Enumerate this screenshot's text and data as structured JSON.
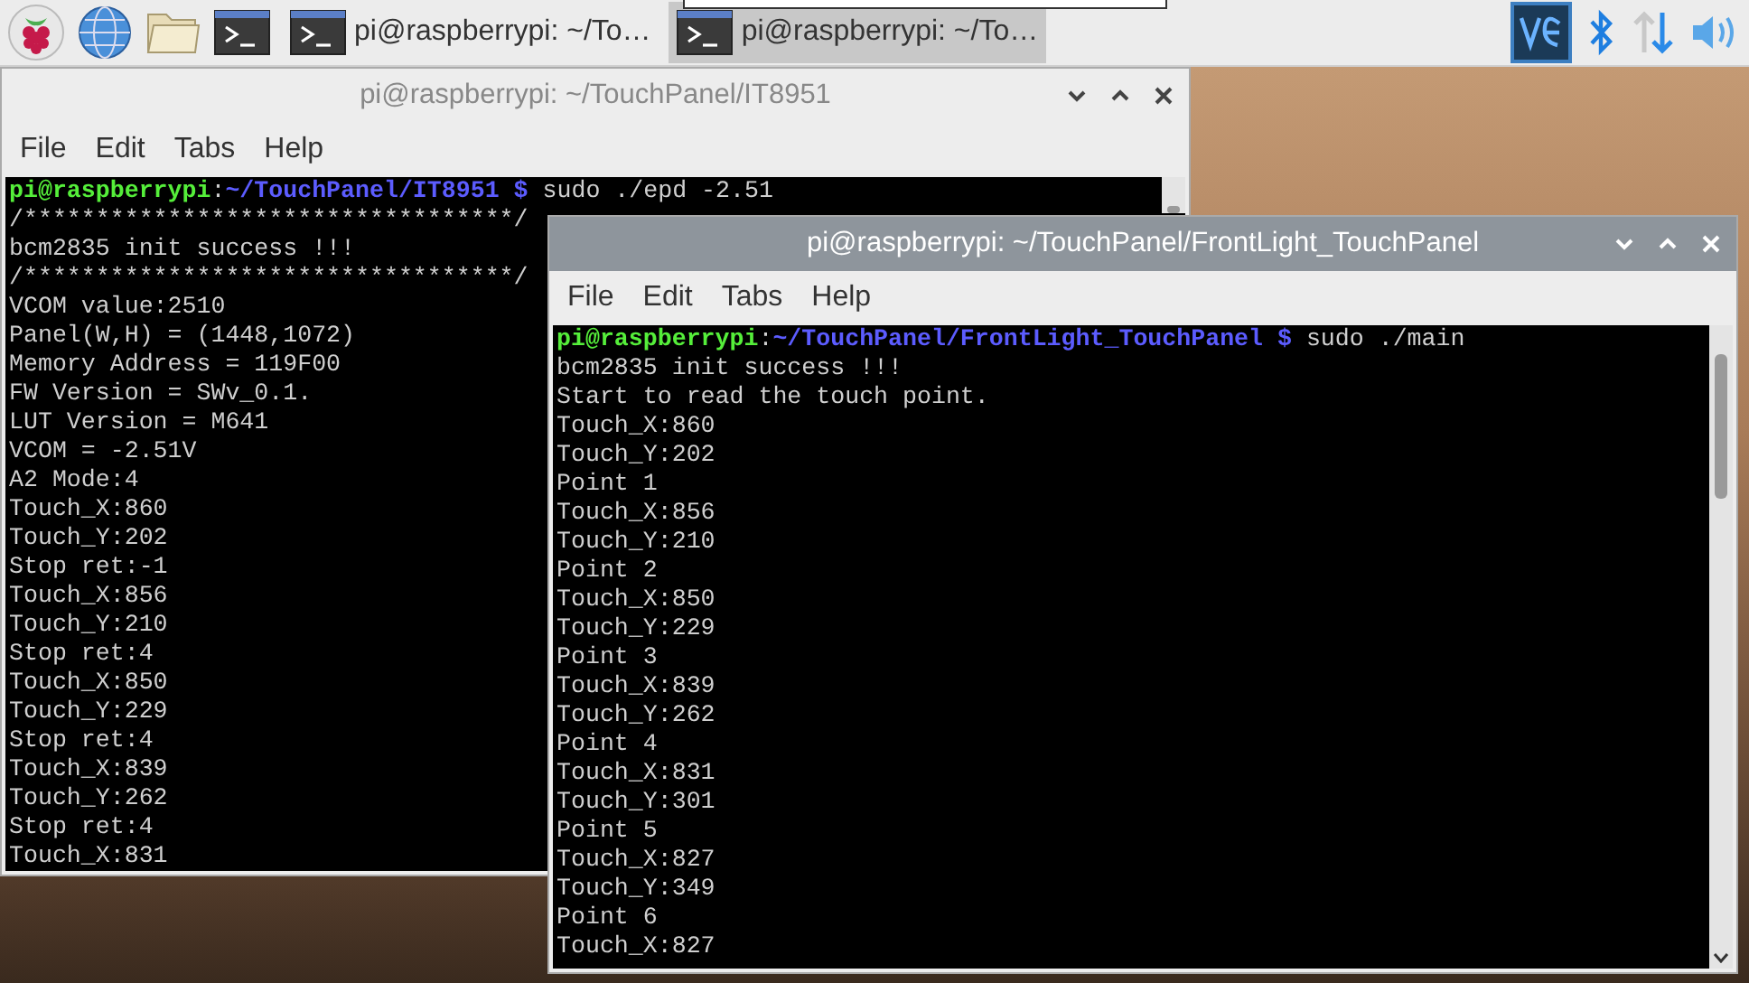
{
  "taskbar": {
    "tasks": [
      {
        "label": "pi@raspberrypi: ~/To…",
        "selected": false
      },
      {
        "label": "pi@raspberrypi: ~/To…",
        "selected": true
      }
    ]
  },
  "windows": [
    {
      "title": "pi@raspberrypi: ~/TouchPanel/IT8951",
      "focused": false,
      "menu": [
        "File",
        "Edit",
        "Tabs",
        "Help"
      ],
      "lines": [
        {
          "kind": "prompt",
          "user": "pi@raspberrypi",
          "separator": ":",
          "path": "~/TouchPanel/IT8951 $",
          "command": "sudo ./epd -2.51"
        },
        {
          "kind": "output",
          "text": "/**********************************/"
        },
        {
          "kind": "output",
          "text": "bcm2835 init success !!!"
        },
        {
          "kind": "output",
          "text": "/**********************************/"
        },
        {
          "kind": "output",
          "text": "VCOM value:2510"
        },
        {
          "kind": "output",
          "text": "Panel(W,H) = (1448,1072)"
        },
        {
          "kind": "output",
          "text": "Memory Address = 119F00"
        },
        {
          "kind": "output",
          "text": "FW Version = SWv_0.1."
        },
        {
          "kind": "output",
          "text": "LUT Version = M641"
        },
        {
          "kind": "output",
          "text": "VCOM = -2.51V"
        },
        {
          "kind": "output",
          "text": "A2 Mode:4"
        },
        {
          "kind": "output",
          "text": "Touch_X:860"
        },
        {
          "kind": "output",
          "text": "Touch_Y:202"
        },
        {
          "kind": "output",
          "text": "Stop ret:-1"
        },
        {
          "kind": "output",
          "text": "Touch_X:856"
        },
        {
          "kind": "output",
          "text": "Touch_Y:210"
        },
        {
          "kind": "output",
          "text": "Stop ret:4"
        },
        {
          "kind": "output",
          "text": "Touch_X:850"
        },
        {
          "kind": "output",
          "text": "Touch_Y:229"
        },
        {
          "kind": "output",
          "text": "Stop ret:4"
        },
        {
          "kind": "output",
          "text": "Touch_X:839"
        },
        {
          "kind": "output",
          "text": "Touch_Y:262"
        },
        {
          "kind": "output",
          "text": "Stop ret:4"
        },
        {
          "kind": "output",
          "text": "Touch_X:831"
        }
      ]
    },
    {
      "title": "pi@raspberrypi: ~/TouchPanel/FrontLight_TouchPanel",
      "focused": true,
      "menu": [
        "File",
        "Edit",
        "Tabs",
        "Help"
      ],
      "lines": [
        {
          "kind": "prompt",
          "user": "pi@raspberrypi",
          "separator": ":",
          "path": "~/TouchPanel/FrontLight_TouchPanel $",
          "command": "sudo ./main"
        },
        {
          "kind": "output",
          "text": "bcm2835 init success !!!"
        },
        {
          "kind": "output",
          "text": "Start to read the touch point."
        },
        {
          "kind": "output",
          "text": "Touch_X:860"
        },
        {
          "kind": "output",
          "text": "Touch_Y:202"
        },
        {
          "kind": "output",
          "text": "Point 1"
        },
        {
          "kind": "output",
          "text": "Touch_X:856"
        },
        {
          "kind": "output",
          "text": "Touch_Y:210"
        },
        {
          "kind": "output",
          "text": "Point 2"
        },
        {
          "kind": "output",
          "text": "Touch_X:850"
        },
        {
          "kind": "output",
          "text": "Touch_Y:229"
        },
        {
          "kind": "output",
          "text": "Point 3"
        },
        {
          "kind": "output",
          "text": "Touch_X:839"
        },
        {
          "kind": "output",
          "text": "Touch_Y:262"
        },
        {
          "kind": "output",
          "text": "Point 4"
        },
        {
          "kind": "output",
          "text": "Touch_X:831"
        },
        {
          "kind": "output",
          "text": "Touch_Y:301"
        },
        {
          "kind": "output",
          "text": "Point 5"
        },
        {
          "kind": "output",
          "text": "Touch_X:827"
        },
        {
          "kind": "output",
          "text": "Touch_Y:349"
        },
        {
          "kind": "output",
          "text": "Point 6"
        },
        {
          "kind": "output",
          "text": "Touch_X:827"
        }
      ]
    }
  ]
}
